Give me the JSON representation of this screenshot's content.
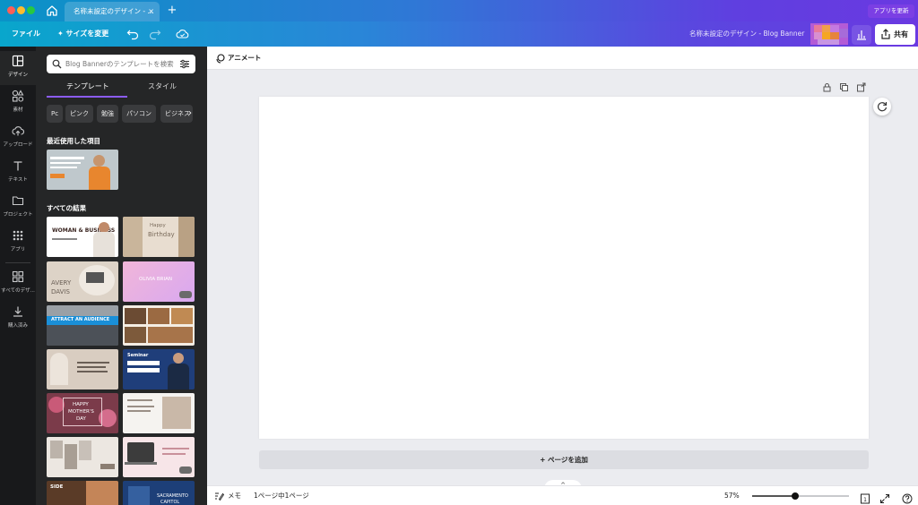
{
  "titlebar": {
    "tab_title": "名称未設定のデザイン - ...",
    "tab_close": "×",
    "new_tab": "+",
    "update_button": "アプリを更新"
  },
  "toolbar": {
    "file": "ファイル",
    "resize": "サイズを変更",
    "design_title": "名称未設定のデザイン - Blog Banner",
    "share": "共有"
  },
  "rail": {
    "items": [
      {
        "label": "デザイン",
        "icon": "layout-icon"
      },
      {
        "label": "素材",
        "icon": "shapes-icon"
      },
      {
        "label": "アップロード",
        "icon": "cloud-upload-icon"
      },
      {
        "label": "テキスト",
        "icon": "text-icon"
      },
      {
        "label": "プロジェクト",
        "icon": "folder-icon"
      },
      {
        "label": "アプリ",
        "icon": "apps-grid-icon"
      },
      {
        "label": "すべてのデザ...",
        "icon": "all-designs-icon"
      },
      {
        "label": "購入済み",
        "icon": "download-icon"
      }
    ]
  },
  "panel": {
    "search_placeholder": "Blog Bannerのテンプレートを検索",
    "tabs": [
      "テンプレート",
      "スタイル"
    ],
    "chips": [
      "Pc",
      "ピンク",
      "勉強",
      "パソコン",
      "ビジネス"
    ],
    "recent_title": "最近使用した項目",
    "all_results_title": "すべての結果",
    "thumbs": {
      "woman_business": "WOMAN & BUSINESS",
      "birthday_1": "Happy",
      "birthday_2": "Birthday",
      "avery_1": "AVERY",
      "avery_2": "DAVIS",
      "olivia": "OLIVIA BRIAN",
      "attract": "ATTRACT AN AUDIENCE",
      "seminar": "Seminar",
      "mothers_1": "HAPPY",
      "mothers_2": "MOTHER'S",
      "mothers_3": "DAY",
      "side": "SIDE",
      "sacramento_1": "SACRAMENTO",
      "sacramento_2": "CAPITOL"
    }
  },
  "canvas": {
    "animate": "アニメート",
    "add_page": "+ ページを追加",
    "collapse": "^"
  },
  "bottombar": {
    "notes": "メモ",
    "page_count": "1ページ中1ページ",
    "zoom": "57%",
    "zoom_level": 0.44,
    "page_badge": "1"
  },
  "colors": {
    "accent": "#8b5cf6",
    "panel_bg": "#252627",
    "rail_bg": "#18191b"
  }
}
